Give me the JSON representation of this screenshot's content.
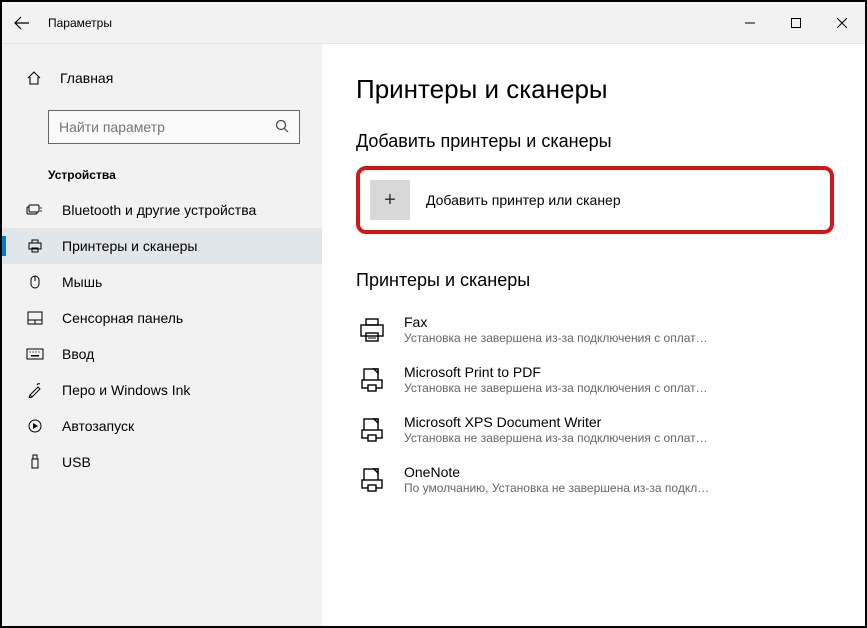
{
  "window": {
    "title": "Параметры"
  },
  "sidebar": {
    "home_label": "Главная",
    "search_placeholder": "Найти параметр",
    "section_title": "Устройства",
    "items": [
      {
        "label": "Bluetooth и другие устройства"
      },
      {
        "label": "Принтеры и сканеры"
      },
      {
        "label": "Мышь"
      },
      {
        "label": "Сенсорная панель"
      },
      {
        "label": "Ввод"
      },
      {
        "label": "Перо и Windows Ink"
      },
      {
        "label": "Автозапуск"
      },
      {
        "label": "USB"
      }
    ]
  },
  "main": {
    "heading": "Принтеры и сканеры",
    "add_section_heading": "Добавить принтеры и сканеры",
    "add_button_label": "Добавить принтер или сканер",
    "list_heading": "Принтеры и сканеры",
    "printers": [
      {
        "name": "Fax",
        "status": "Установка не завершена из-за подключения с оплат…"
      },
      {
        "name": "Microsoft Print to PDF",
        "status": "Установка не завершена из-за подключения с оплат…"
      },
      {
        "name": "Microsoft XPS Document Writer",
        "status": "Установка не завершена из-за подключения с оплат…"
      },
      {
        "name": "OneNote",
        "status": "По умолчанию, Установка не завершена из-за подкл…"
      }
    ]
  }
}
